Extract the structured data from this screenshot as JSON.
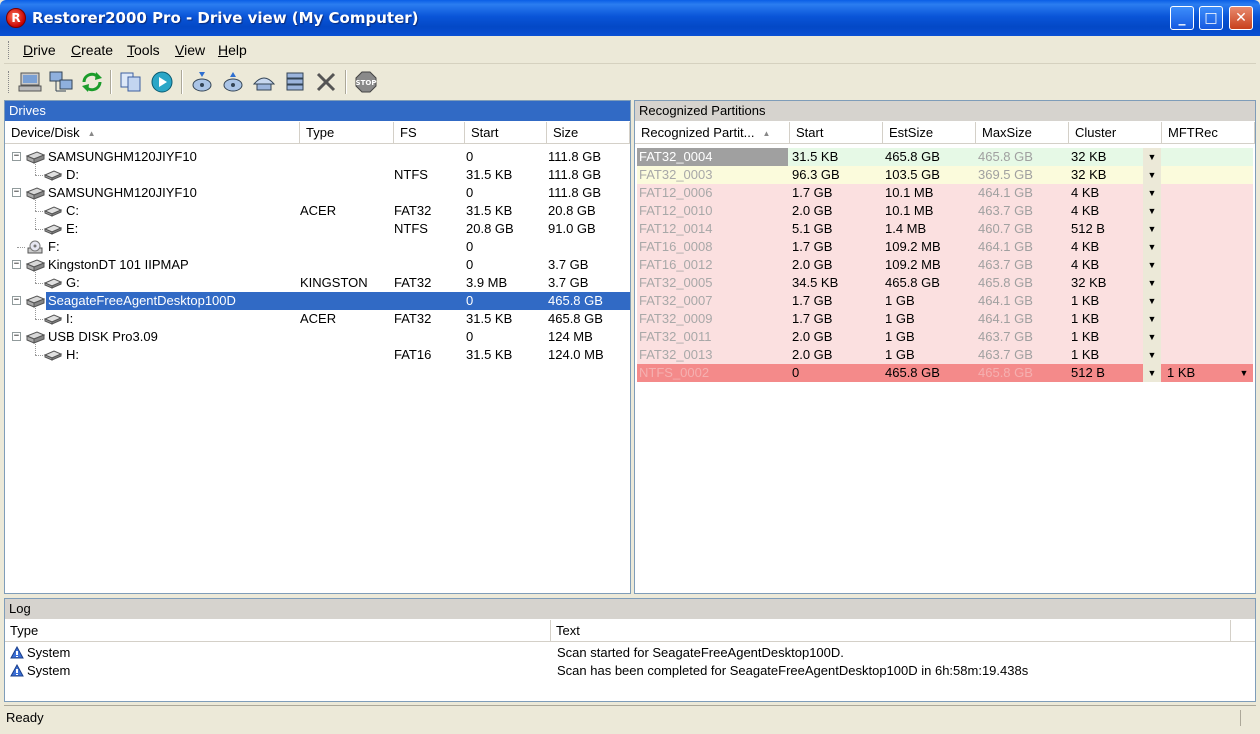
{
  "window": {
    "title": "Restorer2000 Pro - Drive view (My Computer)",
    "minimize": "_",
    "maximize": "□",
    "close": "✕"
  },
  "menu": [
    "Drive",
    "Create",
    "Tools",
    "View",
    "Help"
  ],
  "toolbar": {
    "icons": [
      "computer-icon",
      "network-icon",
      "refresh-icon",
      "copy-icon",
      "play-icon",
      "disk-open-icon",
      "disk-save-icon",
      "region-icon",
      "stack-icon",
      "delete-icon",
      "stop-icon"
    ]
  },
  "drives": {
    "title": "Drives",
    "columns": [
      "Device/Disk",
      "Type",
      "FS",
      "Start",
      "Size"
    ],
    "rows": [
      {
        "level": 0,
        "name": "SAMSUNGHM120JIYF10",
        "type": "",
        "fs": "",
        "start": "0",
        "size": "111.8 GB",
        "icon": "disk"
      },
      {
        "level": 1,
        "name": "D:",
        "type": "",
        "fs": "NTFS",
        "start": "31.5 KB",
        "size": "111.8 GB",
        "icon": "volume"
      },
      {
        "level": 0,
        "name": "SAMSUNGHM120JIYF10",
        "type": "",
        "fs": "",
        "start": "0",
        "size": "111.8 GB",
        "icon": "disk"
      },
      {
        "level": 1,
        "name": "C:",
        "type": "ACER",
        "fs": "FAT32",
        "start": "31.5 KB",
        "size": "20.8 GB",
        "icon": "volume"
      },
      {
        "level": 1,
        "name": "E:",
        "type": "",
        "fs": "NTFS",
        "start": "20.8 GB",
        "size": "91.0 GB",
        "icon": "volume"
      },
      {
        "level": 0,
        "name": "F:",
        "type": "",
        "fs": "",
        "start": "0",
        "size": "",
        "icon": "cdrom"
      },
      {
        "level": 0,
        "name": "KingstonDT 101 IIPMAP",
        "type": "",
        "fs": "",
        "start": "0",
        "size": "3.7 GB",
        "icon": "disk"
      },
      {
        "level": 1,
        "name": "G:",
        "type": "KINGSTON",
        "fs": "FAT32",
        "start": "3.9 MB",
        "size": "3.7 GB",
        "icon": "volume"
      },
      {
        "level": 0,
        "name": "SeagateFreeAgentDesktop100D",
        "type": "",
        "fs": "",
        "start": "0",
        "size": "465.8 GB",
        "icon": "disk",
        "selected": true
      },
      {
        "level": 1,
        "name": "I:",
        "type": "ACER",
        "fs": "FAT32",
        "start": "31.5 KB",
        "size": "465.8 GB",
        "icon": "volume"
      },
      {
        "level": 0,
        "name": "USB DISK Pro3.09",
        "type": "",
        "fs": "",
        "start": "0",
        "size": "124 MB",
        "icon": "disk"
      },
      {
        "level": 1,
        "name": "H:",
        "type": "",
        "fs": "FAT16",
        "start": "31.5 KB",
        "size": "124.0 MB",
        "icon": "volume"
      }
    ]
  },
  "partitions": {
    "title": "Recognized Partitions",
    "columns": [
      "Recognized Partit...",
      "Start",
      "EstSize",
      "MaxSize",
      "Cluster",
      "MFTRec"
    ],
    "rows": [
      {
        "name": "FAT32_0004",
        "start": "31.5 KB",
        "est": "465.8 GB",
        "max": "465.8 GB",
        "cluster": "32 KB",
        "mft": "",
        "bg": "#e6f9e6",
        "selected": true
      },
      {
        "name": "FAT32_0003",
        "start": "96.3 GB",
        "est": "103.5 GB",
        "max": "369.5 GB",
        "cluster": "32 KB",
        "mft": "",
        "bg": "#fbfbdc"
      },
      {
        "name": "FAT12_0006",
        "start": "1.7 GB",
        "est": "10.1 MB",
        "max": "464.1 GB",
        "cluster": "4 KB",
        "mft": "",
        "bg": "#fbe0e0"
      },
      {
        "name": "FAT12_0010",
        "start": "2.0 GB",
        "est": "10.1 MB",
        "max": "463.7 GB",
        "cluster": "4 KB",
        "mft": "",
        "bg": "#fbe0e0"
      },
      {
        "name": "FAT12_0014",
        "start": "5.1 GB",
        "est": "1.4 MB",
        "max": "460.7 GB",
        "cluster": "512 B",
        "mft": "",
        "bg": "#fbe0e0"
      },
      {
        "name": "FAT16_0008",
        "start": "1.7 GB",
        "est": "109.2 MB",
        "max": "464.1 GB",
        "cluster": "4 KB",
        "mft": "",
        "bg": "#fbe0e0"
      },
      {
        "name": "FAT16_0012",
        "start": "2.0 GB",
        "est": "109.2 MB",
        "max": "463.7 GB",
        "cluster": "4 KB",
        "mft": "",
        "bg": "#fbe0e0"
      },
      {
        "name": "FAT32_0005",
        "start": "34.5 KB",
        "est": "465.8 GB",
        "max": "465.8 GB",
        "cluster": "32 KB",
        "mft": "",
        "bg": "#fbe0e0"
      },
      {
        "name": "FAT32_0007",
        "start": "1.7 GB",
        "est": "1 GB",
        "max": "464.1 GB",
        "cluster": "1 KB",
        "mft": "",
        "bg": "#fbe0e0"
      },
      {
        "name": "FAT32_0009",
        "start": "1.7 GB",
        "est": "1 GB",
        "max": "464.1 GB",
        "cluster": "1 KB",
        "mft": "",
        "bg": "#fbe0e0"
      },
      {
        "name": "FAT32_0011",
        "start": "2.0 GB",
        "est": "1 GB",
        "max": "463.7 GB",
        "cluster": "1 KB",
        "mft": "",
        "bg": "#fbe0e0"
      },
      {
        "name": "FAT32_0013",
        "start": "2.0 GB",
        "est": "1 GB",
        "max": "463.7 GB",
        "cluster": "1 KB",
        "mft": "",
        "bg": "#fbe0e0"
      },
      {
        "name": "NTFS_0002",
        "start": "0",
        "est": "465.8 GB",
        "max": "465.8 GB",
        "cluster": "512 B",
        "mft": "1 KB",
        "bg": "#f48a8a",
        "mft_dropdown": true
      }
    ]
  },
  "log": {
    "title": "Log",
    "columns": [
      "Type",
      "Text"
    ],
    "rows": [
      {
        "type": "System",
        "text": "Scan started for SeagateFreeAgentDesktop100D."
      },
      {
        "type": "System",
        "text": "Scan has been completed for SeagateFreeAgentDesktop100D in 6h:58m:19.438s"
      }
    ]
  },
  "status": {
    "text": "Ready"
  }
}
